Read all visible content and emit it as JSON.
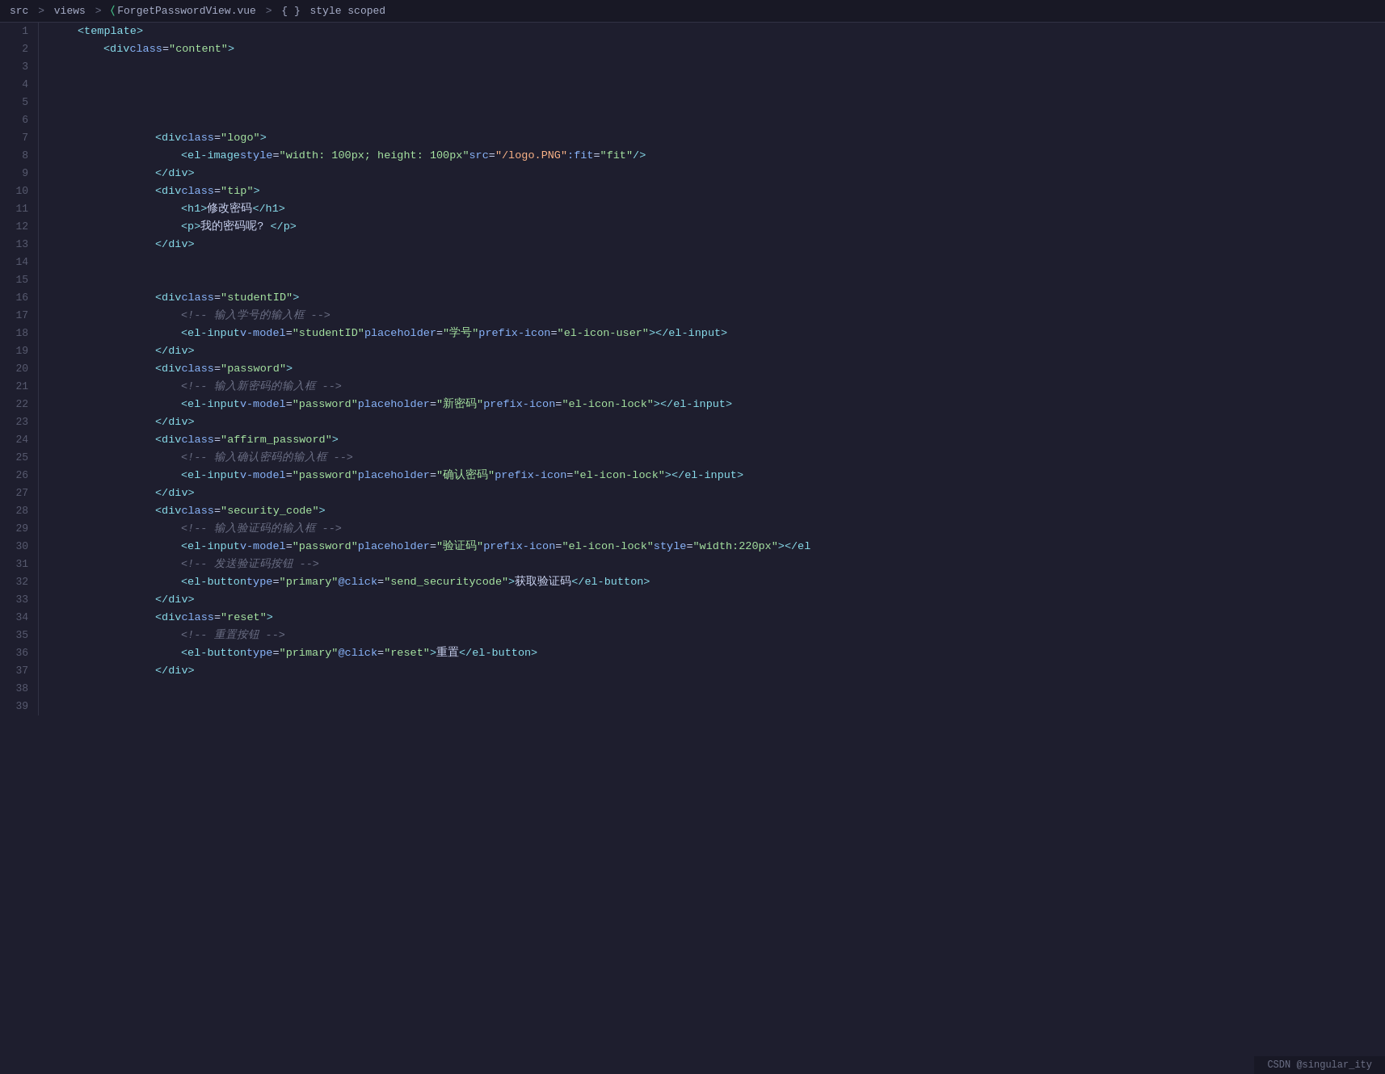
{
  "breadcrumb": {
    "parts": [
      {
        "label": "src",
        "type": "dir"
      },
      {
        "label": ">",
        "type": "sep"
      },
      {
        "label": "views",
        "type": "dir"
      },
      {
        "label": ">",
        "type": "sep"
      },
      {
        "label": "ForgetPasswordView.vue",
        "type": "vue-file"
      },
      {
        "label": ">",
        "type": "sep"
      },
      {
        "label": "{ }",
        "type": "icon"
      },
      {
        "label": "style scoped",
        "type": "highlight"
      }
    ]
  },
  "lines": [
    {
      "num": 1,
      "tokens": [
        {
          "t": "indent",
          "w": 32
        },
        {
          "t": "tag-open",
          "v": "<template>"
        },
        {
          "t": "tag-close",
          "v": ""
        }
      ]
    },
    {
      "num": 2,
      "tokens": [
        {
          "t": "indent",
          "w": 64
        },
        {
          "t": "tag-open",
          "v": "<div"
        },
        {
          "t": "space"
        },
        {
          "t": "attr-name",
          "v": "class"
        },
        {
          "t": "equals",
          "v": "="
        },
        {
          "t": "attr-value",
          "v": "\"content\""
        },
        {
          "t": "punct",
          "v": ">"
        }
      ]
    },
    {
      "num": 3,
      "tokens": []
    },
    {
      "num": 4,
      "tokens": []
    },
    {
      "num": 5,
      "tokens": []
    },
    {
      "num": 6,
      "tokens": []
    },
    {
      "num": 7,
      "tokens": [
        {
          "t": "indent",
          "w": 128
        },
        {
          "t": "tag-open",
          "v": "<div"
        },
        {
          "t": "space"
        },
        {
          "t": "attr-name",
          "v": "class"
        },
        {
          "t": "equals",
          "v": "="
        },
        {
          "t": "attr-value",
          "v": "\"logo\""
        },
        {
          "t": "punct",
          "v": ">"
        }
      ]
    },
    {
      "num": 8,
      "tokens": [
        {
          "t": "indent",
          "w": 160
        },
        {
          "t": "tag-open",
          "v": "<el-image"
        },
        {
          "t": "space"
        },
        {
          "t": "attr-name",
          "v": "style"
        },
        {
          "t": "equals",
          "v": "="
        },
        {
          "t": "attr-value",
          "v": "\"width: 100px; height: 100px\""
        },
        {
          "t": "space"
        },
        {
          "t": "attr-name",
          "v": "src"
        },
        {
          "t": "equals",
          "v": "="
        },
        {
          "t": "attr-value-orange",
          "v": "\"/logo.PNG\""
        },
        {
          "t": "space"
        },
        {
          "t": "attr-name",
          "v": ":fit"
        },
        {
          "t": "equals",
          "v": "="
        },
        {
          "t": "attr-value",
          "v": "\"fit\""
        },
        {
          "t": "space"
        },
        {
          "t": "punct",
          "v": "/>"
        }
      ]
    },
    {
      "num": 9,
      "tokens": [
        {
          "t": "indent",
          "w": 128
        },
        {
          "t": "tag-close-full",
          "v": "</div>"
        }
      ]
    },
    {
      "num": 10,
      "tokens": [
        {
          "t": "indent",
          "w": 128
        },
        {
          "t": "tag-open",
          "v": "<div"
        },
        {
          "t": "space"
        },
        {
          "t": "attr-name",
          "v": "class"
        },
        {
          "t": "equals",
          "v": "="
        },
        {
          "t": "attr-value",
          "v": "\"tip\""
        },
        {
          "t": "punct",
          "v": ">"
        }
      ]
    },
    {
      "num": 11,
      "tokens": [
        {
          "t": "indent",
          "w": 160
        },
        {
          "t": "tag-open",
          "v": "<h1"
        },
        {
          "t": "punct",
          "v": ">"
        },
        {
          "t": "text",
          "v": "修改密码"
        },
        {
          "t": "tag-close-full",
          "v": "</h1>"
        }
      ]
    },
    {
      "num": 12,
      "tokens": [
        {
          "t": "indent",
          "w": 160
        },
        {
          "t": "tag-open",
          "v": "<p"
        },
        {
          "t": "punct",
          "v": ">"
        },
        {
          "t": "text",
          "v": "我的密码呢? "
        },
        {
          "t": "tag-close-full",
          "v": "</p>"
        }
      ]
    },
    {
      "num": 13,
      "tokens": [
        {
          "t": "indent",
          "w": 128
        },
        {
          "t": "tag-close-full",
          "v": "</div>"
        }
      ]
    },
    {
      "num": 14,
      "tokens": []
    },
    {
      "num": 15,
      "tokens": []
    },
    {
      "num": 16,
      "tokens": [
        {
          "t": "indent",
          "w": 128
        },
        {
          "t": "tag-open",
          "v": "<div"
        },
        {
          "t": "space"
        },
        {
          "t": "attr-name",
          "v": "class"
        },
        {
          "t": "equals",
          "v": "="
        },
        {
          "t": "attr-value",
          "v": "\"studentID\""
        },
        {
          "t": "punct",
          "v": ">"
        }
      ]
    },
    {
      "num": 17,
      "tokens": [
        {
          "t": "indent",
          "w": 160
        },
        {
          "t": "comment",
          "v": "<!-- 输入学号的输入框 -->"
        }
      ]
    },
    {
      "num": 18,
      "tokens": [
        {
          "t": "indent",
          "w": 160
        },
        {
          "t": "tag-open",
          "v": "<el-input"
        },
        {
          "t": "space"
        },
        {
          "t": "attr-name",
          "v": "v-model"
        },
        {
          "t": "equals",
          "v": "="
        },
        {
          "t": "attr-value",
          "v": "\"studentID\""
        },
        {
          "t": "space"
        },
        {
          "t": "attr-name",
          "v": "placeholder"
        },
        {
          "t": "equals",
          "v": "="
        },
        {
          "t": "attr-value",
          "v": "\"学号\""
        },
        {
          "t": "space"
        },
        {
          "t": "attr-name",
          "v": "prefix-icon"
        },
        {
          "t": "equals",
          "v": "="
        },
        {
          "t": "attr-value",
          "v": "\"el-icon-user\""
        },
        {
          "t": "punct",
          "v": "></el-input>"
        }
      ]
    },
    {
      "num": 19,
      "tokens": [
        {
          "t": "indent",
          "w": 128
        },
        {
          "t": "tag-close-full",
          "v": "</div>"
        }
      ]
    },
    {
      "num": 20,
      "tokens": [
        {
          "t": "indent",
          "w": 128
        },
        {
          "t": "tag-open",
          "v": "<div"
        },
        {
          "t": "space"
        },
        {
          "t": "attr-name",
          "v": "class"
        },
        {
          "t": "equals",
          "v": "="
        },
        {
          "t": "attr-value",
          "v": "\"password\""
        },
        {
          "t": "punct",
          "v": ">"
        }
      ]
    },
    {
      "num": 21,
      "tokens": [
        {
          "t": "indent",
          "w": 160
        },
        {
          "t": "comment",
          "v": "<!-- 输入新密码的输入框 -->"
        }
      ]
    },
    {
      "num": 22,
      "tokens": [
        {
          "t": "indent",
          "w": 160
        },
        {
          "t": "tag-open",
          "v": "<el-input"
        },
        {
          "t": "space"
        },
        {
          "t": "attr-name",
          "v": "v-model"
        },
        {
          "t": "equals",
          "v": "="
        },
        {
          "t": "attr-value",
          "v": "\"password\""
        },
        {
          "t": "space"
        },
        {
          "t": "attr-name",
          "v": "placeholder"
        },
        {
          "t": "equals",
          "v": "="
        },
        {
          "t": "attr-value",
          "v": "\"新密码\""
        },
        {
          "t": "space"
        },
        {
          "t": "attr-name",
          "v": "prefix-icon"
        },
        {
          "t": "equals",
          "v": "="
        },
        {
          "t": "attr-value",
          "v": "\"el-icon-lock\""
        },
        {
          "t": "punct",
          "v": "></el-input>"
        }
      ]
    },
    {
      "num": 23,
      "tokens": [
        {
          "t": "indent",
          "w": 128
        },
        {
          "t": "tag-close-full",
          "v": "</div>"
        }
      ]
    },
    {
      "num": 24,
      "tokens": [
        {
          "t": "indent",
          "w": 128
        },
        {
          "t": "tag-open",
          "v": "<div"
        },
        {
          "t": "space"
        },
        {
          "t": "attr-name",
          "v": "class"
        },
        {
          "t": "equals",
          "v": "="
        },
        {
          "t": "attr-value",
          "v": "\"affirm_password\""
        },
        {
          "t": "punct",
          "v": ">"
        }
      ]
    },
    {
      "num": 25,
      "tokens": [
        {
          "t": "indent",
          "w": 160
        },
        {
          "t": "comment",
          "v": "<!-- 输入确认密码的输入框 -->"
        }
      ]
    },
    {
      "num": 26,
      "tokens": [
        {
          "t": "indent",
          "w": 160
        },
        {
          "t": "tag-open",
          "v": "<el-input"
        },
        {
          "t": "space"
        },
        {
          "t": "attr-name",
          "v": "v-model"
        },
        {
          "t": "equals",
          "v": "="
        },
        {
          "t": "attr-value",
          "v": "\"password\""
        },
        {
          "t": "space"
        },
        {
          "t": "attr-name",
          "v": "placeholder"
        },
        {
          "t": "equals",
          "v": "="
        },
        {
          "t": "attr-value",
          "v": "\"确认密码\""
        },
        {
          "t": "space"
        },
        {
          "t": "attr-name",
          "v": "prefix-icon"
        },
        {
          "t": "equals",
          "v": "="
        },
        {
          "t": "attr-value",
          "v": "\"el-icon-lock\""
        },
        {
          "t": "punct",
          "v": "></el-input>"
        }
      ]
    },
    {
      "num": 27,
      "tokens": [
        {
          "t": "indent",
          "w": 128
        },
        {
          "t": "tag-close-full",
          "v": "</div>"
        }
      ]
    },
    {
      "num": 28,
      "tokens": [
        {
          "t": "indent",
          "w": 128
        },
        {
          "t": "tag-open",
          "v": "<div"
        },
        {
          "t": "space"
        },
        {
          "t": "attr-name",
          "v": "class"
        },
        {
          "t": "equals",
          "v": "="
        },
        {
          "t": "attr-value",
          "v": "\"security_code\""
        },
        {
          "t": "punct",
          "v": ">"
        }
      ]
    },
    {
      "num": 29,
      "tokens": [
        {
          "t": "indent",
          "w": 160
        },
        {
          "t": "comment",
          "v": "<!-- 输入验证码的输入框 -->"
        }
      ]
    },
    {
      "num": 30,
      "tokens": [
        {
          "t": "indent",
          "w": 160
        },
        {
          "t": "tag-open",
          "v": "<el-input"
        },
        {
          "t": "space"
        },
        {
          "t": "attr-name",
          "v": "v-model"
        },
        {
          "t": "equals",
          "v": "="
        },
        {
          "t": "attr-value",
          "v": "\"password\""
        },
        {
          "t": "space"
        },
        {
          "t": "attr-name",
          "v": "placeholder"
        },
        {
          "t": "equals",
          "v": "="
        },
        {
          "t": "attr-value",
          "v": "\"验证码\""
        },
        {
          "t": "space"
        },
        {
          "t": "attr-name",
          "v": "prefix-icon"
        },
        {
          "t": "equals",
          "v": "="
        },
        {
          "t": "attr-value",
          "v": "\"el-icon-lock\""
        },
        {
          "t": "space"
        },
        {
          "t": "attr-name",
          "v": "style"
        },
        {
          "t": "equals",
          "v": "="
        },
        {
          "t": "attr-value",
          "v": "\"width:220px\""
        },
        {
          "t": "punct",
          "v": "></el"
        }
      ]
    },
    {
      "num": 31,
      "tokens": [
        {
          "t": "indent",
          "w": 160
        },
        {
          "t": "comment",
          "v": "<!-- 发送验证码按钮 -->"
        }
      ]
    },
    {
      "num": 32,
      "tokens": [
        {
          "t": "indent",
          "w": 160
        },
        {
          "t": "tag-open",
          "v": "<el-button"
        },
        {
          "t": "space"
        },
        {
          "t": "attr-name",
          "v": "type"
        },
        {
          "t": "equals",
          "v": "="
        },
        {
          "t": "attr-value",
          "v": "\"primary\""
        },
        {
          "t": "space"
        },
        {
          "t": "attr-name",
          "v": "@click"
        },
        {
          "t": "equals",
          "v": "="
        },
        {
          "t": "attr-value",
          "v": "\"send_securitycode\""
        },
        {
          "t": "punct",
          "v": ">"
        },
        {
          "t": "text",
          "v": "获取验证码"
        },
        {
          "t": "tag-close-full",
          "v": "</el-button>"
        }
      ]
    },
    {
      "num": 33,
      "tokens": [
        {
          "t": "indent",
          "w": 128
        },
        {
          "t": "tag-close-full",
          "v": "</div>"
        }
      ]
    },
    {
      "num": 34,
      "tokens": [
        {
          "t": "indent",
          "w": 128
        },
        {
          "t": "tag-open",
          "v": "<div"
        },
        {
          "t": "space"
        },
        {
          "t": "attr-name",
          "v": "class"
        },
        {
          "t": "equals",
          "v": "="
        },
        {
          "t": "attr-value",
          "v": "\"reset\""
        },
        {
          "t": "punct",
          "v": ">"
        }
      ]
    },
    {
      "num": 35,
      "tokens": [
        {
          "t": "indent",
          "w": 160
        },
        {
          "t": "comment",
          "v": "<!-- 重置按钮 -->"
        }
      ]
    },
    {
      "num": 36,
      "tokens": [
        {
          "t": "indent",
          "w": 160
        },
        {
          "t": "tag-open",
          "v": "<el-button"
        },
        {
          "t": "space"
        },
        {
          "t": "attr-name",
          "v": "type"
        },
        {
          "t": "equals",
          "v": "="
        },
        {
          "t": "attr-value",
          "v": "\"primary\""
        },
        {
          "t": "space"
        },
        {
          "t": "attr-name",
          "v": "@click"
        },
        {
          "t": "equals",
          "v": "="
        },
        {
          "t": "attr-value",
          "v": "\"reset\""
        },
        {
          "t": "punct",
          "v": ">"
        },
        {
          "t": "text",
          "v": "重置"
        },
        {
          "t": "tag-close-full",
          "v": "</el-button>"
        }
      ]
    },
    {
      "num": 37,
      "tokens": [
        {
          "t": "indent",
          "w": 128
        },
        {
          "t": "tag-close-full",
          "v": "</div>"
        }
      ]
    },
    {
      "num": 38,
      "tokens": []
    },
    {
      "num": 39,
      "tokens": []
    }
  ],
  "status_bar": {
    "label": "CSDN @singular_ity"
  }
}
